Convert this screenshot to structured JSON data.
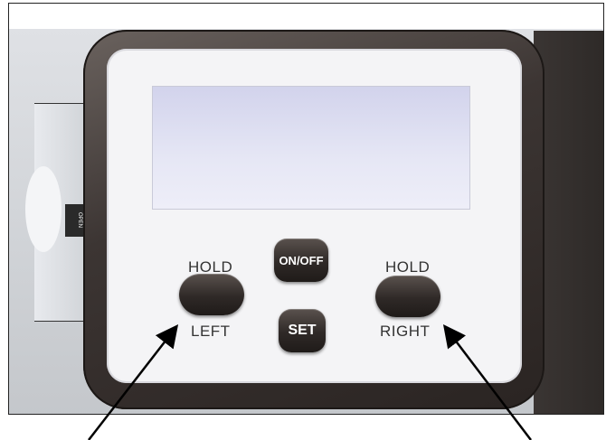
{
  "labels": {
    "hold_left": "HOLD",
    "left": "LEFT",
    "hold_right": "HOLD",
    "right": "RIGHT",
    "on_off": "ON/OFF",
    "set": "SET",
    "open": "OPEN"
  },
  "colors": {
    "bezel": "#3c3533",
    "face": "#f4f4f6",
    "lcd": "#e2e3f3",
    "button": "#2f2927"
  }
}
